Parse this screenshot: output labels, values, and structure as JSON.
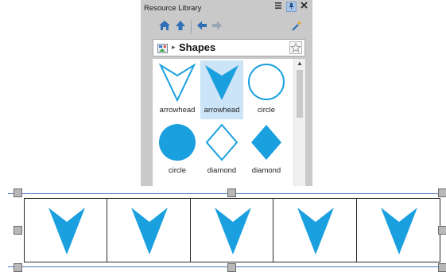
{
  "panel": {
    "title": "Resource Library",
    "breadcrumb": "Shapes"
  },
  "shapes": [
    {
      "label": "arrowhead",
      "shape": "arrowhead-outline",
      "selected": false
    },
    {
      "label": "arrowhead",
      "shape": "arrowhead-filled",
      "selected": true
    },
    {
      "label": "circle",
      "shape": "circle-outline",
      "selected": false
    },
    {
      "label": "circle",
      "shape": "circle-filled",
      "selected": false
    },
    {
      "label": "diamond",
      "shape": "diamond-outline",
      "selected": false
    },
    {
      "label": "diamond",
      "shape": "diamond-filled",
      "selected": false
    }
  ],
  "canvas": {
    "repeat_count": 5,
    "shape": "arrowhead-filled"
  },
  "colors": {
    "accent": "#1a9fdf",
    "selection": "#cce4f7",
    "guide": "#4f7bbf"
  },
  "icons": [
    "home-icon",
    "up-icon",
    "back-icon",
    "forward-icon",
    "wand-icon",
    "shapes-folder-icon",
    "favorite-star-icon"
  ]
}
